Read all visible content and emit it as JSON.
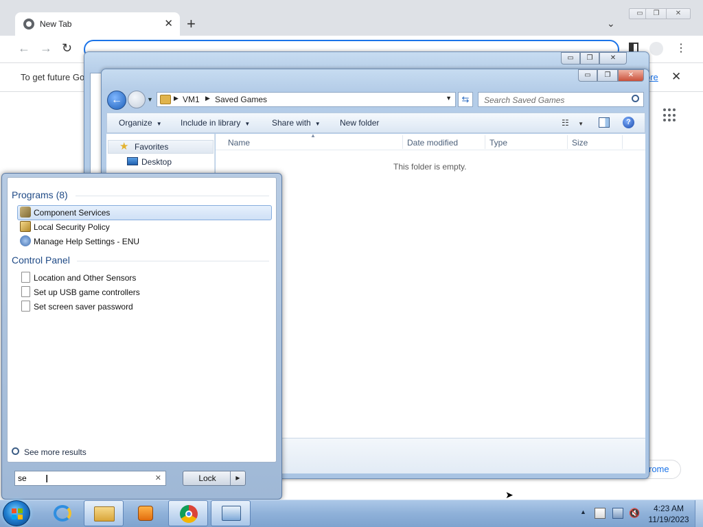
{
  "chrome": {
    "tab_title": "New Tab",
    "tab_close": "✕",
    "new_tab": "+",
    "tab_search": "⌄",
    "back": "←",
    "forward": "→",
    "reload": "↻",
    "infobar_text": "To get future Go",
    "infobar_link": "ore",
    "infobar_close": "✕",
    "bottom_button": "rome",
    "window_buttons": [
      "▭",
      "❐",
      "✕"
    ]
  },
  "explorer_back": {
    "window_buttons": [
      "▭",
      "❐",
      "✕"
    ]
  },
  "explorer": {
    "window_buttons": [
      "▭",
      "❐",
      "✕"
    ],
    "breadcrumb": [
      "VM1",
      "Saved Games"
    ],
    "search_placeholder": "Search Saved Games",
    "toolbar": {
      "organize": "Organize",
      "include_in_library": "Include in library",
      "share_with": "Share with",
      "new_folder": "New folder"
    },
    "nav": {
      "favorites": "Favorites",
      "desktop": "Desktop"
    },
    "columns": [
      "Name",
      "Date modified",
      "Type",
      "Size"
    ],
    "empty_message": "This folder is empty."
  },
  "start_menu": {
    "programs_header": "Programs (8)",
    "programs": [
      "Component Services",
      "Local Security Policy",
      "Manage Help Settings - ENU"
    ],
    "control_panel_header": "Control Panel",
    "control_panel": [
      "Location and Other Sensors",
      "Set up USB game controllers",
      "Set screen saver password"
    ],
    "see_more": "See more results",
    "search_value": "se",
    "search_clear": "✕",
    "lock_label": "Lock",
    "lock_arrow": "▶"
  },
  "taskbar": {
    "time": "4:23 AM",
    "date": "11/19/2023"
  },
  "colors": {
    "accent": "#1a73e8",
    "aero_blue": "#b5cde8",
    "header_blue": "#1f4a86"
  }
}
